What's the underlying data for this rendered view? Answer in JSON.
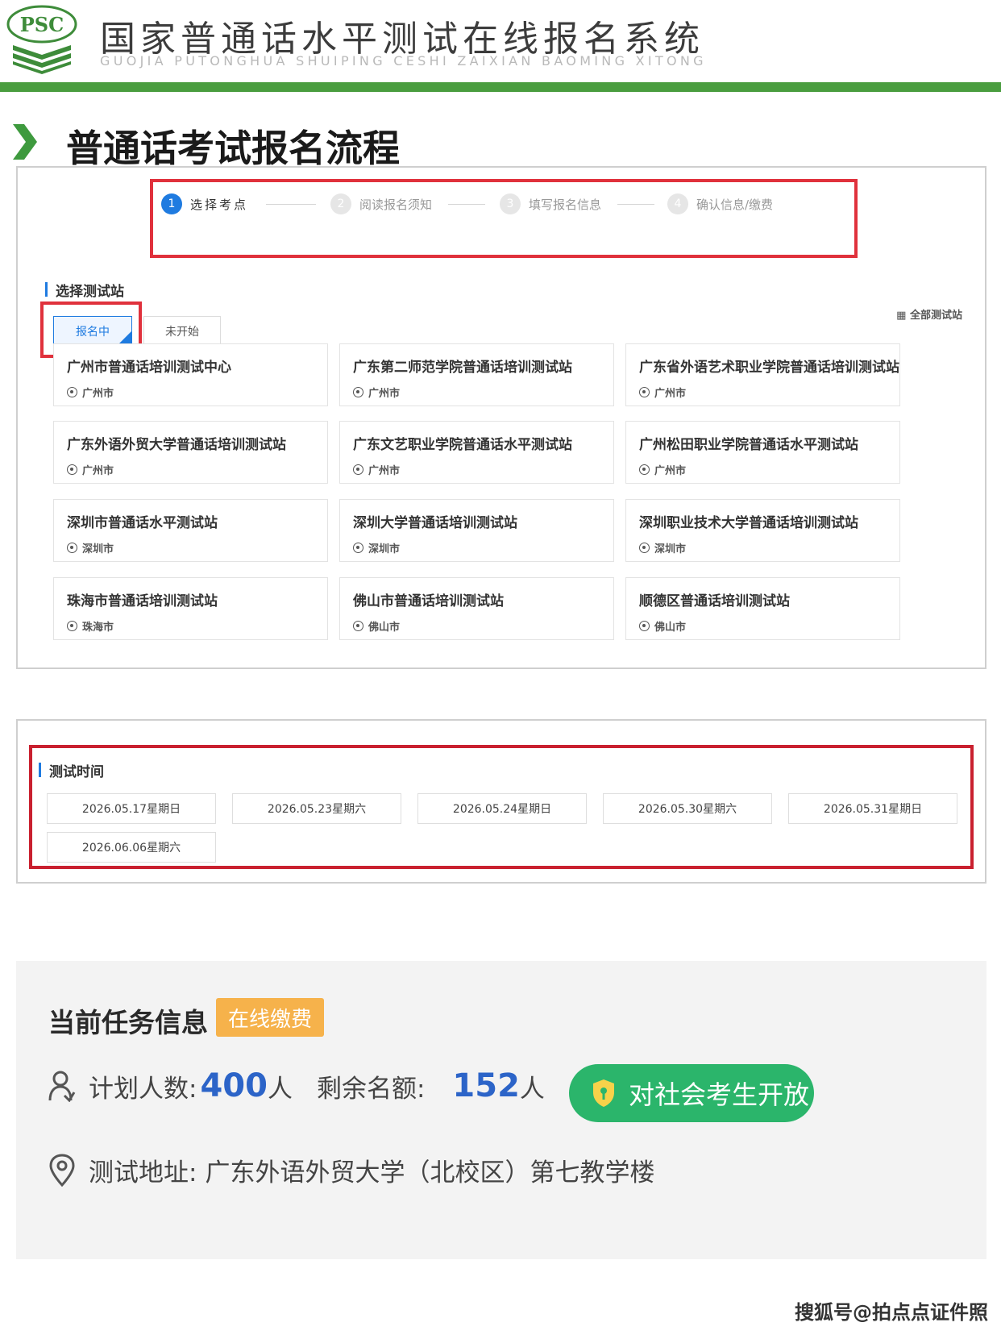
{
  "header": {
    "logo_text": "PSC",
    "title": "国家普通话水平测试在线报名系统",
    "subtitle": "GUOJIA PUTONGHUA SHUIPING CESHI ZAIXIAN BAOMING XITONG"
  },
  "section": {
    "title": "普通话考试报名流程"
  },
  "steps": [
    {
      "num": "1",
      "label": "选择考点"
    },
    {
      "num": "2",
      "label": "阅读报名须知"
    },
    {
      "num": "3",
      "label": "填写报名信息"
    },
    {
      "num": "4",
      "label": "确认信息/缴费"
    }
  ],
  "station_section": {
    "title": "选择测试站",
    "tabs": [
      "报名中",
      "未开始"
    ],
    "all_link": "全部测试站",
    "stations": [
      {
        "name": "广州市普通话培训测试中心",
        "city": "广州市"
      },
      {
        "name": "广东第二师范学院普通话培训测试站",
        "city": "广州市"
      },
      {
        "name": "广东省外语艺术职业学院普通话培训测试站",
        "city": "广州市"
      },
      {
        "name": "广东外语外贸大学普通话培训测试站",
        "city": "广州市"
      },
      {
        "name": "广东文艺职业学院普通话水平测试站",
        "city": "广州市"
      },
      {
        "name": "广州松田职业学院普通话水平测试站",
        "city": "广州市"
      },
      {
        "name": "深圳市普通话水平测试站",
        "city": "深圳市"
      },
      {
        "name": "深圳大学普通话培训测试站",
        "city": "深圳市"
      },
      {
        "name": "深圳职业技术大学普通话培训测试站",
        "city": "深圳市"
      },
      {
        "name": "珠海市普通话培训测试站",
        "city": "珠海市"
      },
      {
        "name": "佛山市普通话培训测试站",
        "city": "佛山市"
      },
      {
        "name": "顺德区普通话培训测试站",
        "city": "佛山市"
      }
    ]
  },
  "test_time": {
    "title": "测试时间",
    "dates": [
      "2026.05.17星期日",
      "2026.05.23星期六",
      "2026.05.24星期日",
      "2026.05.30星期六",
      "2026.05.31星期日",
      "2026.06.06星期六"
    ]
  },
  "task_info": {
    "title": "当前任务信息",
    "badge": "在线缴费",
    "planned_label": "计划人数:",
    "planned_value": "400",
    "planned_unit": "人",
    "remaining_label": "剩余名额:",
    "remaining_value": "152",
    "remaining_unit": "人",
    "open_label": "对社会考生开放",
    "address_label": "测试地址:",
    "address_value": "广东外语外贸大学（北校区）第七教学楼"
  },
  "watermark": "搜狐号@拍点点证件照",
  "colors": {
    "brand_green": "#4a9d3f",
    "highlight_red": "#e0313c",
    "accent_blue": "#1f7be0",
    "open_green": "#2bb56b",
    "badge_orange": "#f6b24b"
  }
}
